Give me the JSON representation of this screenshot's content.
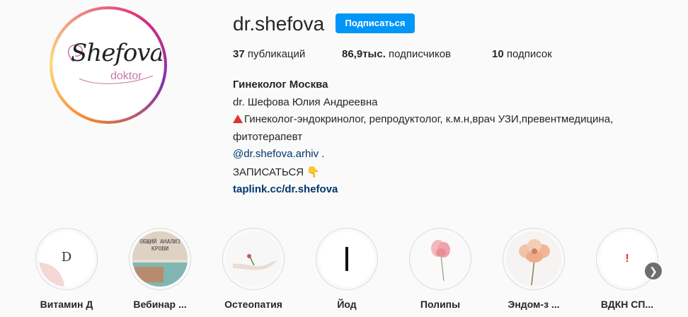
{
  "profile": {
    "username": "dr.shefova",
    "follow_label": "Подписаться",
    "avatar": {
      "logo_main": "Shefova",
      "logo_sub": "doktor"
    }
  },
  "stats": {
    "posts_count": "37",
    "posts_label": "публикаций",
    "followers_count": "86,9тыс.",
    "followers_label": "подписчиков",
    "following_count": "10",
    "following_label": "подписок"
  },
  "bio": {
    "name": "Гинеколог Москва",
    "line1": "dr. Шефова Юлия Андреевна",
    "line2": "Гинеколог-эндокринолог, репродуктолог, к.м.н,врач УЗИ,превентмедицина,",
    "line3": "фитотерапевт",
    "mention": "@dr.shefova.arhiv",
    "mention_suffix": " .",
    "cta": "ЗАПИСАТЬСЯ",
    "cta_emoji": "👇",
    "website": "taplink.cc/dr.shefova"
  },
  "highlights": [
    {
      "label": "Витамин Д",
      "icon": "vitamin-d-cover",
      "cover_text": "D"
    },
    {
      "label": "Вебинар ...",
      "icon": "webinar-cover",
      "cover_text": "общий анализ крови"
    },
    {
      "label": "Остеопатия",
      "icon": "hand-flower-cover"
    },
    {
      "label": "Йод",
      "icon": "iodine-cover"
    },
    {
      "label": "Полипы",
      "icon": "pink-flower-cover"
    },
    {
      "label": "Эндом-з ...",
      "icon": "peach-flower-cover"
    },
    {
      "label": "ВДКН СП...",
      "icon": "exclamation-cover",
      "cover_text": "!"
    }
  ],
  "colors": {
    "follow_button": "#0095f6",
    "link": "#00376b",
    "background": "#fafafa",
    "warning_triangle": "#e0322f"
  },
  "icons": {
    "next": "chevron-right-icon"
  }
}
